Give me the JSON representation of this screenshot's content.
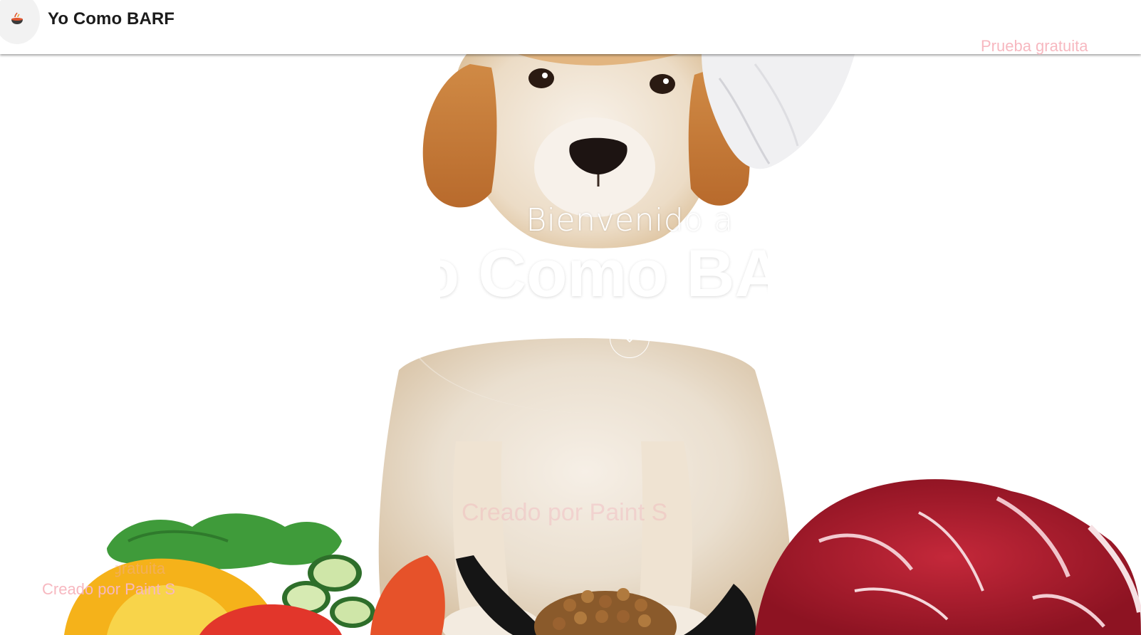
{
  "header": {
    "brand": "Yo Como BARF",
    "logo_icon": "bowl-of-food-icon",
    "cta_label": "Prueba gratuita"
  },
  "hero": {
    "welcome_text": "Bienvenido a",
    "title": "Yo Como BARF",
    "scroll_icon": "double-chevron-down-icon",
    "background_image": "golden-retriever-puppy-chef-hat-with-vegetables-and-raw-meat"
  },
  "overlay": {
    "faded_center_text": "Creado por Paint S",
    "faded_small_text": "gratuita",
    "credit_text": "Creado por Paint S"
  },
  "colors": {
    "header_bg": "#ffffff",
    "brand_text": "#1b1b1b",
    "cta_pink": "#f7b8c0",
    "hero_text": "#ffffff"
  }
}
